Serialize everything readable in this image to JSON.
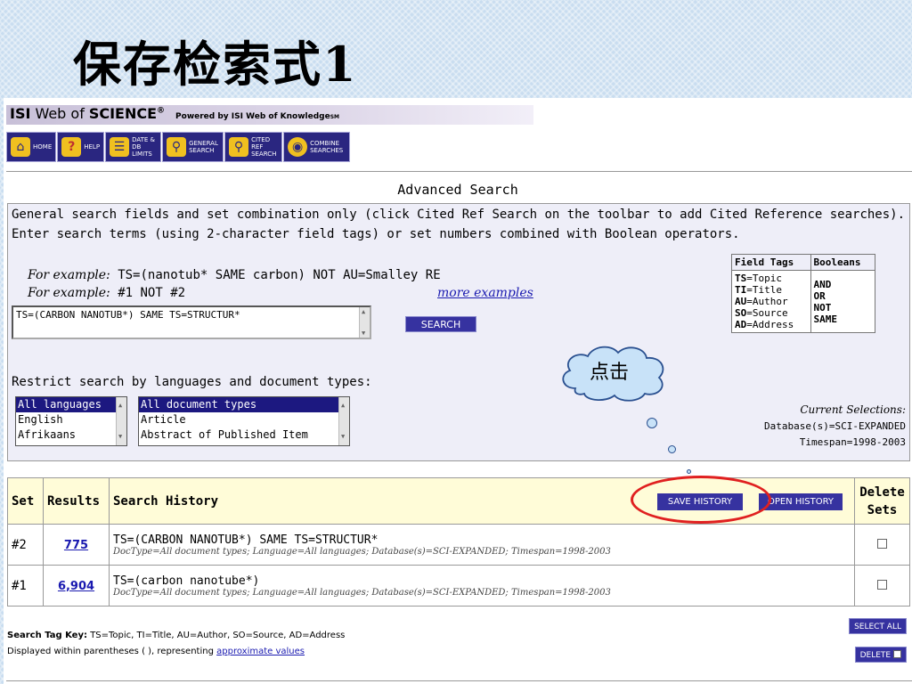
{
  "slide": {
    "title": "保存检索式1"
  },
  "header": {
    "brand_isi": "ISI",
    "brand_wos": "Web of",
    "brand_science": "SCIENCE",
    "brand_reg": "®",
    "powered": "Powered by ISI Web of Knowledge",
    "powered_sm": "SM"
  },
  "toolbar": [
    {
      "icon": "home-icon",
      "label": "HOME"
    },
    {
      "icon": "help-icon",
      "label": "HELP"
    },
    {
      "icon": "date-limits-icon",
      "label": "DATE & DB LIMITS"
    },
    {
      "icon": "general-search-icon",
      "label": "GENERAL SEARCH"
    },
    {
      "icon": "cited-ref-search-icon",
      "label": "CITED REF SEARCH"
    },
    {
      "icon": "combine-searches-icon",
      "label": "COMBINE SEARCHES"
    }
  ],
  "advanced": {
    "title": "Advanced Search",
    "intro1": "General search fields and set combination only (click Cited Ref Search on the toolbar to add Cited Reference searches).",
    "intro2": "Enter search terms (using 2-character field tags) or set numbers combined with Boolean operators.",
    "example_label": "For example:",
    "example1": "TS=(nanotub* SAME carbon) NOT AU=Smalley RE",
    "example2": "#1 NOT #2",
    "more_examples": "more examples",
    "query_value": "TS=(CARBON NANOTUB*) SAME TS=STRUCTUR*",
    "search_button": "SEARCH",
    "restrict_label": "Restrict search by languages and document types:"
  },
  "field_tags": {
    "header_tags": "Field Tags",
    "header_booleans": "Booleans",
    "tags": [
      {
        "tag": "TS",
        "name": "=Topic"
      },
      {
        "tag": "TI",
        "name": "=Title"
      },
      {
        "tag": "AU",
        "name": "=Author"
      },
      {
        "tag": "SO",
        "name": "=Source"
      },
      {
        "tag": "AD",
        "name": "=Address"
      }
    ],
    "booleans": [
      "AND",
      "OR",
      "NOT",
      "SAME"
    ]
  },
  "languages": [
    "All languages",
    "English",
    "Afrikaans"
  ],
  "doc_types": [
    "All document types",
    "Article",
    "Abstract of Published Item"
  ],
  "current_selections": {
    "label": "Current Selections:",
    "database": "Database(s)=SCI-EXPANDED",
    "timespan": "Timespan=1998-2003"
  },
  "callout": {
    "label": "点击"
  },
  "history": {
    "col_set": "Set",
    "col_results": "Results",
    "col_history": "Search History",
    "col_delete1": "Delete",
    "col_delete2": "Sets",
    "save_button": "SAVE HISTORY",
    "open_button": "OPEN HISTORY",
    "rows": [
      {
        "set": "#2",
        "results": "775",
        "query": "TS=(CARBON NANOTUB*) SAME TS=STRUCTUR*",
        "details": "DocType=All document types; Language=All languages; Database(s)=SCI-EXPANDED; Timespan=1998-2003"
      },
      {
        "set": "#1",
        "results": "6,904",
        "query": "TS=(carbon nanotube*)",
        "details": "DocType=All document types; Language=All languages; Database(s)=SCI-EXPANDED; Timespan=1998-2003"
      }
    ]
  },
  "footer": {
    "key_label": "Search Tag Key:",
    "key_text": "TS=Topic, TI=Title, AU=Author, SO=Source, AD=Address",
    "displayed": "Displayed within parentheses ( ), representing",
    "approx_link": "approximate values",
    "select_all": "SELECT ALL",
    "delete": "DELETE"
  },
  "colors": {
    "accent": "#3632a0",
    "highlight_ring": "#e02020",
    "history_header_bg": "#fffcd8"
  }
}
